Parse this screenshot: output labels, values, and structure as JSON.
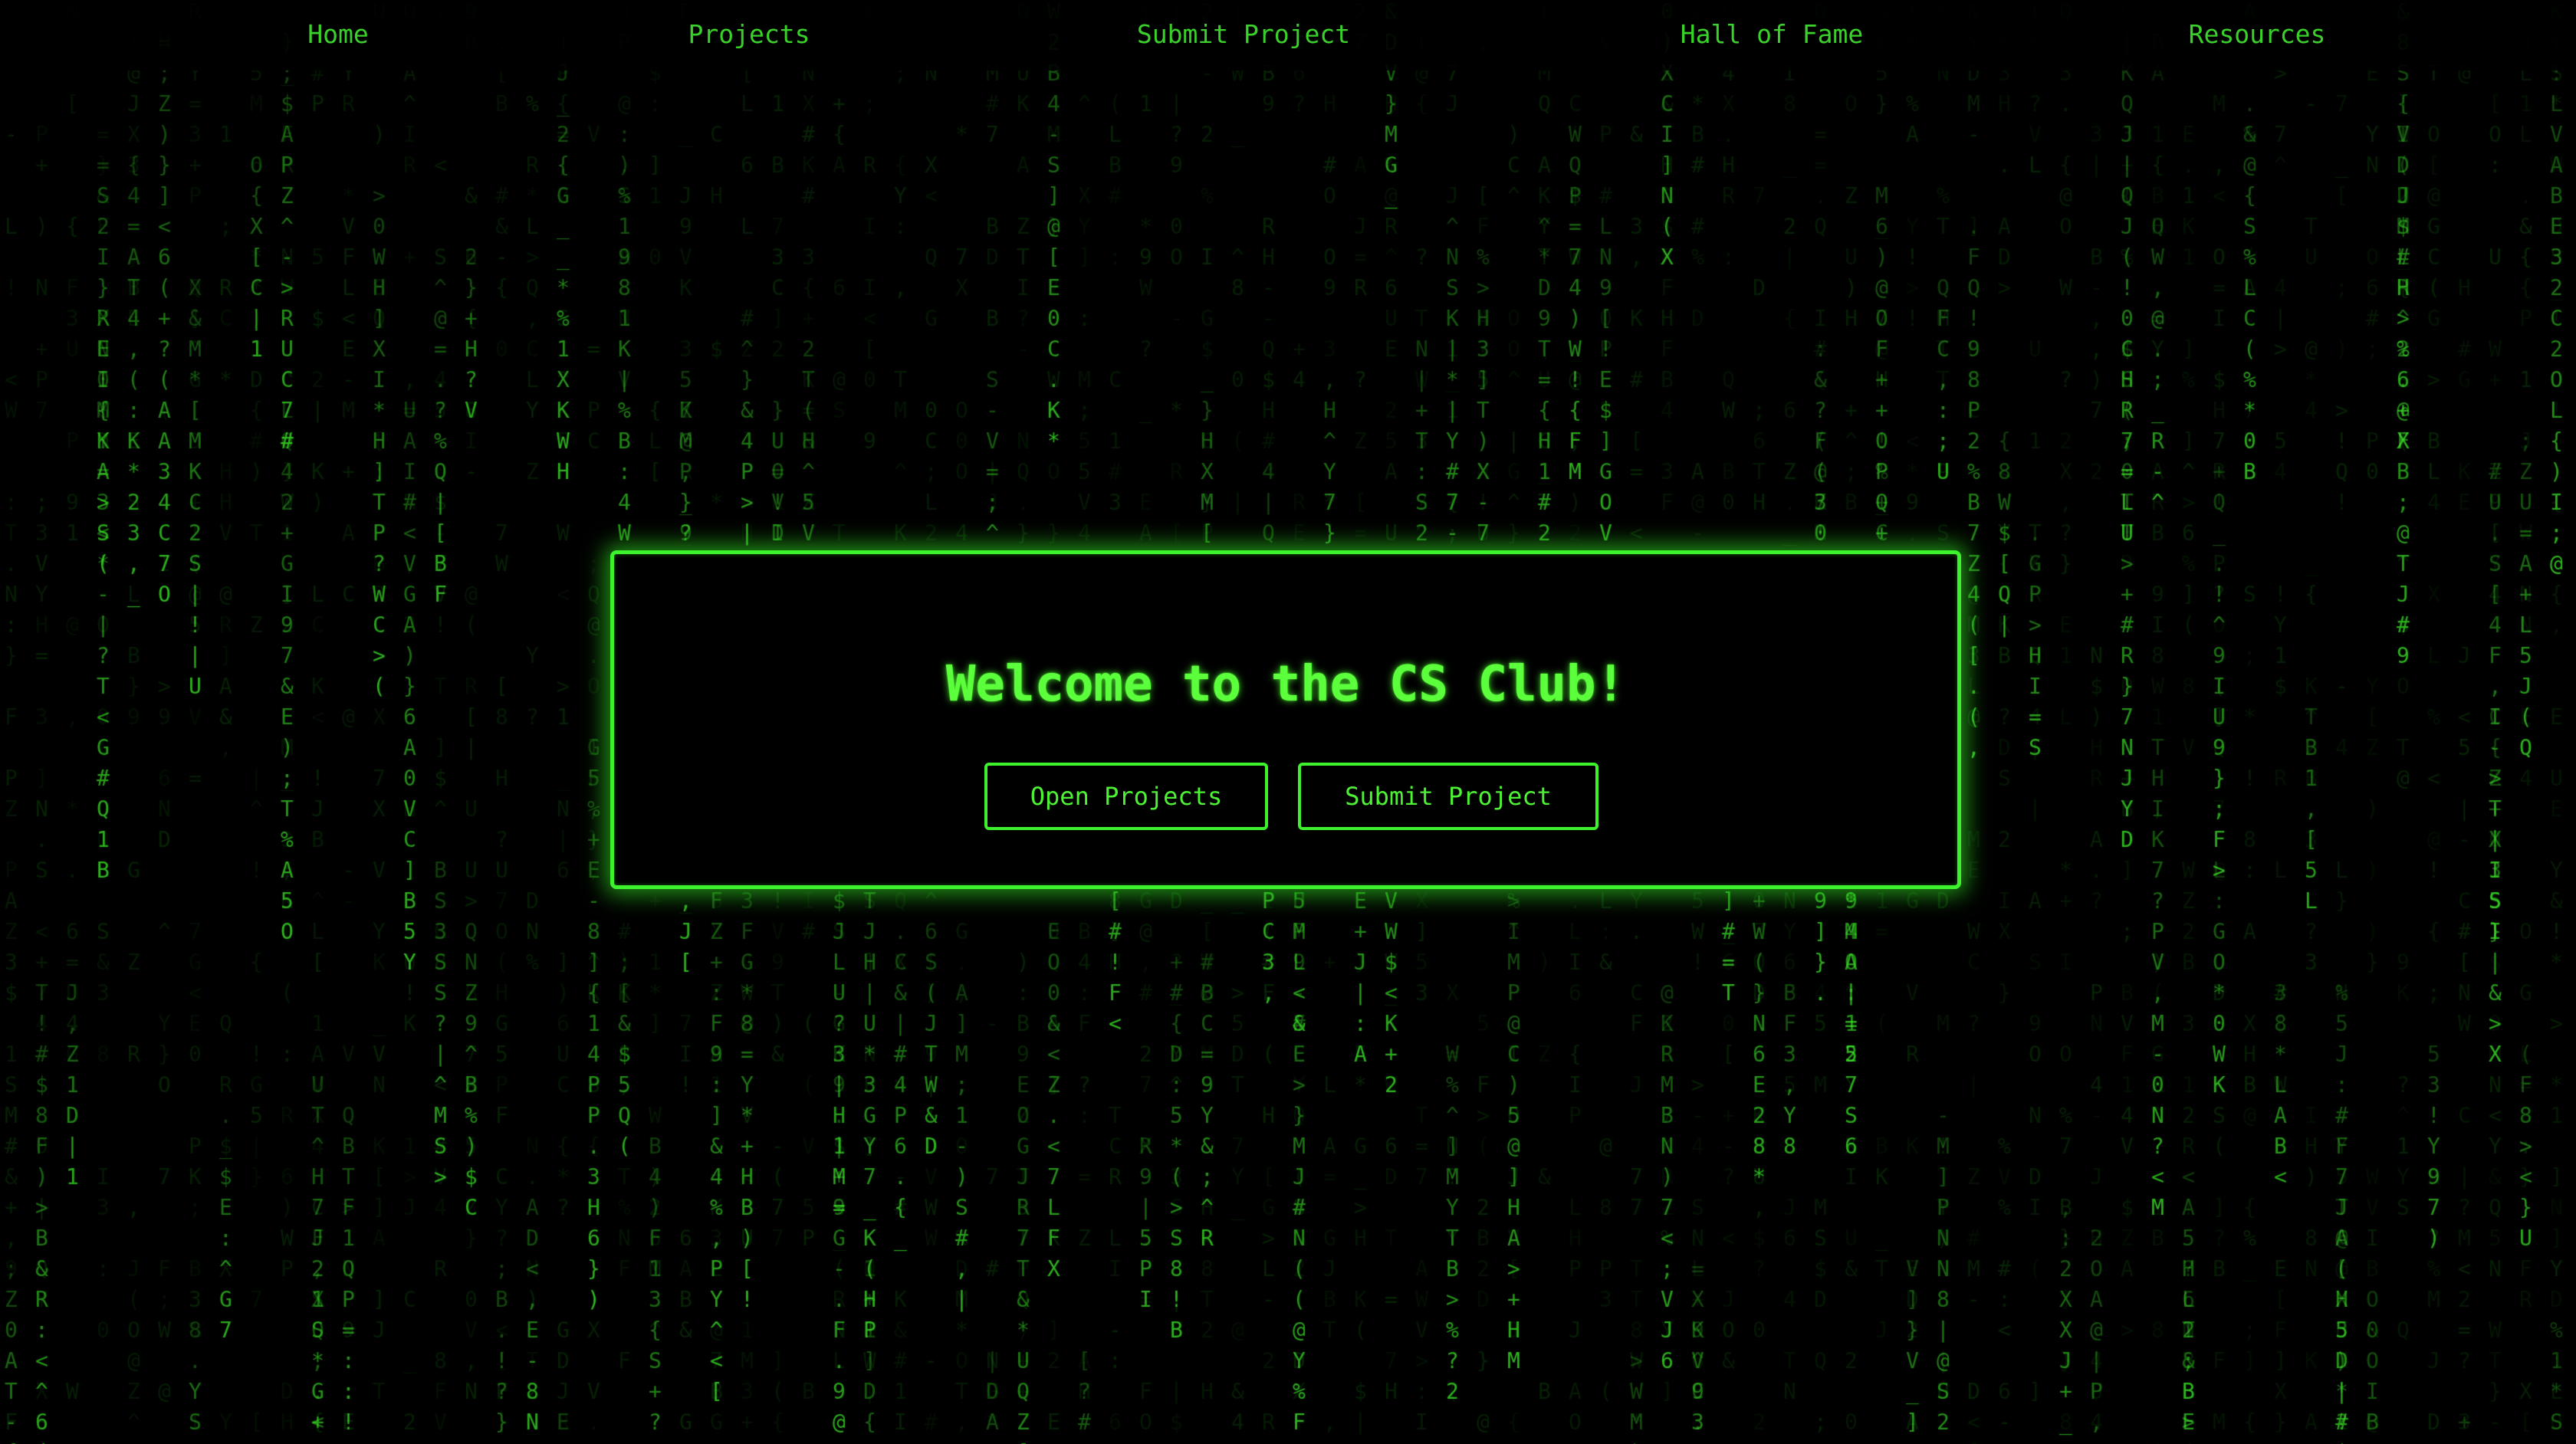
{
  "theme": {
    "background": "#000000",
    "accent": "#3df22d",
    "text_green": "#39d12a",
    "title_green": "#5cff3b"
  },
  "nav": {
    "items": [
      {
        "label": "Home"
      },
      {
        "label": "Projects"
      },
      {
        "label": "Submit Project"
      },
      {
        "label": "Hall of Fame"
      },
      {
        "label": "Resources"
      }
    ]
  },
  "hero": {
    "title": "Welcome to the CS Club!",
    "buttons": [
      {
        "label": "Open Projects"
      },
      {
        "label": "Submit Project"
      }
    ]
  },
  "background": {
    "effect": "matrix-code-rain",
    "charset": "ABCDEFGHIJKLMNOPQRSTUVWXYZ0123456789@#$%&*+-=<>?!;:{}[]()|^_.,"
  }
}
